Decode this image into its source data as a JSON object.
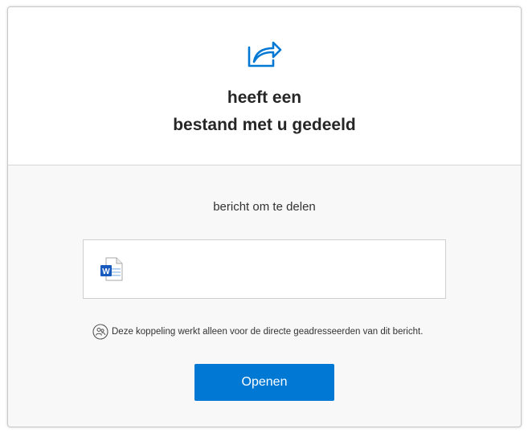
{
  "header": {
    "icon": "share-arrow-icon",
    "title_line1": "heeft een",
    "title_line2": "bestand met u gedeeld"
  },
  "body": {
    "message": "bericht om te delen",
    "file": {
      "icon": "word-document-icon",
      "name": ""
    },
    "notice": {
      "icon": "people-icon",
      "text": "Deze koppeling werkt alleen voor de directe geadresseerden van dit bericht."
    },
    "open_button_label": "Openen"
  },
  "colors": {
    "accent": "#0078d4",
    "word_blue": "#185abd",
    "header_bg": "#ffffff",
    "body_bg": "#f8f8f8"
  }
}
